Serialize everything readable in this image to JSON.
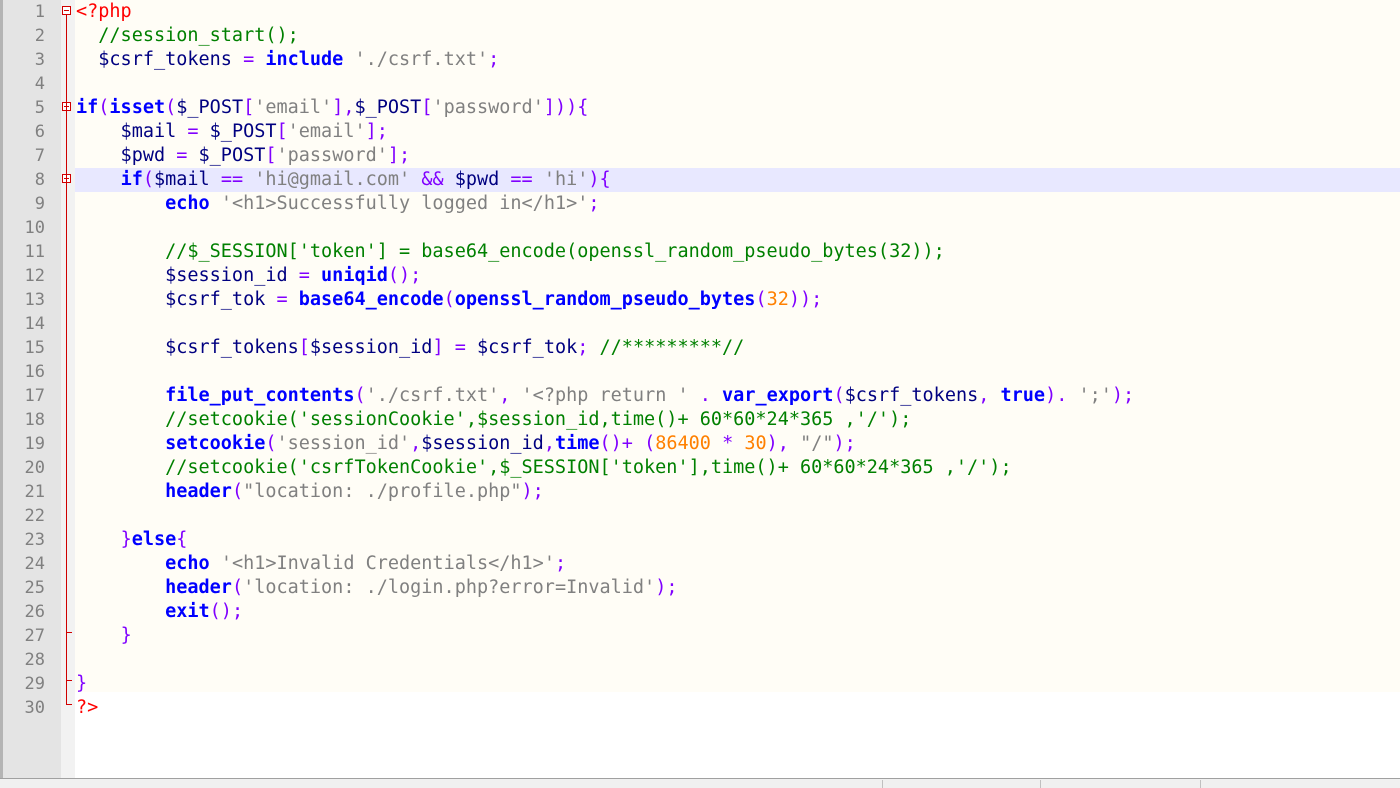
{
  "editor": {
    "colors": {
      "php_tag": "#ff0000",
      "comment": "#008000",
      "variable": "#000080",
      "operator": "#8000ff",
      "keyword": "#0000ff",
      "string": "#808080",
      "number": "#ff8000",
      "current_line": "#e8e8ff",
      "background": "#fffdf6"
    },
    "current_line": 8,
    "line_numbers": [
      "1",
      "2",
      "3",
      "4",
      "5",
      "6",
      "7",
      "8",
      "9",
      "10",
      "11",
      "12",
      "13",
      "14",
      "15",
      "16",
      "17",
      "18",
      "19",
      "20",
      "21",
      "22",
      "23",
      "24",
      "25",
      "26",
      "27",
      "28",
      "29",
      "30"
    ],
    "lines": [
      [
        {
          "t": "tag",
          "v": "<?php"
        }
      ],
      [
        {
          "t": "cmt",
          "v": "  //session_start();"
        }
      ],
      [
        {
          "t": "var",
          "v": "  $csrf_tokens "
        },
        {
          "t": "op",
          "v": "="
        },
        {
          "t": "plain",
          "v": " "
        },
        {
          "t": "kw",
          "v": "include"
        },
        {
          "t": "plain",
          "v": " "
        },
        {
          "t": "str",
          "v": "'./csrf.txt'"
        },
        {
          "t": "op",
          "v": ";"
        }
      ],
      [],
      [
        {
          "t": "kw",
          "v": "if"
        },
        {
          "t": "op",
          "v": "("
        },
        {
          "t": "kw",
          "v": "isset"
        },
        {
          "t": "op",
          "v": "("
        },
        {
          "t": "var",
          "v": "$_POST"
        },
        {
          "t": "op",
          "v": "["
        },
        {
          "t": "str",
          "v": "'email'"
        },
        {
          "t": "op",
          "v": "],"
        },
        {
          "t": "var",
          "v": "$_POST"
        },
        {
          "t": "op",
          "v": "["
        },
        {
          "t": "str",
          "v": "'password'"
        },
        {
          "t": "op",
          "v": "])){"
        }
      ],
      [
        {
          "t": "var",
          "v": "    $mail "
        },
        {
          "t": "op",
          "v": "="
        },
        {
          "t": "var",
          "v": " $_POST"
        },
        {
          "t": "op",
          "v": "["
        },
        {
          "t": "str",
          "v": "'email'"
        },
        {
          "t": "op",
          "v": "];"
        }
      ],
      [
        {
          "t": "var",
          "v": "    $pwd "
        },
        {
          "t": "op",
          "v": "="
        },
        {
          "t": "var",
          "v": " $_POST"
        },
        {
          "t": "op",
          "v": "["
        },
        {
          "t": "str",
          "v": "'password'"
        },
        {
          "t": "op",
          "v": "];"
        }
      ],
      [
        {
          "t": "plain",
          "v": "    "
        },
        {
          "t": "kw",
          "v": "if"
        },
        {
          "t": "op",
          "v": "("
        },
        {
          "t": "var",
          "v": "$mail "
        },
        {
          "t": "op",
          "v": "=="
        },
        {
          "t": "plain",
          "v": " "
        },
        {
          "t": "str",
          "v": "'hi@gmail.com'"
        },
        {
          "t": "plain",
          "v": " "
        },
        {
          "t": "op",
          "v": "&&"
        },
        {
          "t": "var",
          "v": " $pwd "
        },
        {
          "t": "op",
          "v": "=="
        },
        {
          "t": "plain",
          "v": " "
        },
        {
          "t": "str",
          "v": "'hi'"
        },
        {
          "t": "op",
          "v": "){"
        }
      ],
      [
        {
          "t": "plain",
          "v": "        "
        },
        {
          "t": "kw",
          "v": "echo"
        },
        {
          "t": "plain",
          "v": " "
        },
        {
          "t": "str",
          "v": "'<h1>Successfully logged in</h1>'"
        },
        {
          "t": "op",
          "v": ";"
        }
      ],
      [],
      [
        {
          "t": "cmt",
          "v": "        //$_SESSION['token'] = base64_encode(openssl_random_pseudo_bytes(32));"
        }
      ],
      [
        {
          "t": "var",
          "v": "        $session_id "
        },
        {
          "t": "op",
          "v": "="
        },
        {
          "t": "plain",
          "v": " "
        },
        {
          "t": "kw",
          "v": "uniqid"
        },
        {
          "t": "op",
          "v": "();"
        }
      ],
      [
        {
          "t": "var",
          "v": "        $csrf_tok "
        },
        {
          "t": "op",
          "v": "="
        },
        {
          "t": "plain",
          "v": " "
        },
        {
          "t": "kw",
          "v": "base64_encode"
        },
        {
          "t": "op",
          "v": "("
        },
        {
          "t": "kw",
          "v": "openssl_random_pseudo_bytes"
        },
        {
          "t": "op",
          "v": "("
        },
        {
          "t": "num",
          "v": "32"
        },
        {
          "t": "op",
          "v": "));"
        }
      ],
      [],
      [
        {
          "t": "var",
          "v": "        $csrf_tokens"
        },
        {
          "t": "op",
          "v": "["
        },
        {
          "t": "var",
          "v": "$session_id"
        },
        {
          "t": "op",
          "v": "]"
        },
        {
          "t": "plain",
          "v": " "
        },
        {
          "t": "op",
          "v": "="
        },
        {
          "t": "var",
          "v": " $csrf_tok"
        },
        {
          "t": "op",
          "v": ";"
        },
        {
          "t": "plain",
          "v": " "
        },
        {
          "t": "cmt",
          "v": "//*********//"
        }
      ],
      [],
      [
        {
          "t": "plain",
          "v": "        "
        },
        {
          "t": "kw",
          "v": "file_put_contents"
        },
        {
          "t": "op",
          "v": "("
        },
        {
          "t": "str",
          "v": "'./csrf.txt'"
        },
        {
          "t": "op",
          "v": ","
        },
        {
          "t": "plain",
          "v": " "
        },
        {
          "t": "str",
          "v": "'<?php return '"
        },
        {
          "t": "plain",
          "v": " "
        },
        {
          "t": "op",
          "v": "."
        },
        {
          "t": "plain",
          "v": " "
        },
        {
          "t": "kw",
          "v": "var_export"
        },
        {
          "t": "op",
          "v": "("
        },
        {
          "t": "var",
          "v": "$csrf_tokens"
        },
        {
          "t": "op",
          "v": ","
        },
        {
          "t": "plain",
          "v": " "
        },
        {
          "t": "kw",
          "v": "true"
        },
        {
          "t": "op",
          "v": ")."
        },
        {
          "t": "plain",
          "v": " "
        },
        {
          "t": "str",
          "v": "';'"
        },
        {
          "t": "op",
          "v": ");"
        }
      ],
      [
        {
          "t": "cmt",
          "v": "        //setcookie('sessionCookie',$session_id,time()+ 60*60*24*365 ,'/');"
        }
      ],
      [
        {
          "t": "plain",
          "v": "        "
        },
        {
          "t": "kw",
          "v": "setcookie"
        },
        {
          "t": "op",
          "v": "("
        },
        {
          "t": "str",
          "v": "'session_id'"
        },
        {
          "t": "op",
          "v": ","
        },
        {
          "t": "var",
          "v": "$session_id"
        },
        {
          "t": "op",
          "v": ","
        },
        {
          "t": "kw",
          "v": "time"
        },
        {
          "t": "op",
          "v": "()+"
        },
        {
          "t": "plain",
          "v": " "
        },
        {
          "t": "op",
          "v": "("
        },
        {
          "t": "num",
          "v": "86400"
        },
        {
          "t": "plain",
          "v": " "
        },
        {
          "t": "op",
          "v": "*"
        },
        {
          "t": "plain",
          "v": " "
        },
        {
          "t": "num",
          "v": "30"
        },
        {
          "t": "op",
          "v": "),"
        },
        {
          "t": "plain",
          "v": " "
        },
        {
          "t": "str",
          "v": "\"/\""
        },
        {
          "t": "op",
          "v": ");"
        }
      ],
      [
        {
          "t": "cmt",
          "v": "        //setcookie('csrfTokenCookie',$_SESSION['token'],time()+ 60*60*24*365 ,'/');"
        }
      ],
      [
        {
          "t": "plain",
          "v": "        "
        },
        {
          "t": "kw",
          "v": "header"
        },
        {
          "t": "op",
          "v": "("
        },
        {
          "t": "str",
          "v": "\"location: ./profile.php\""
        },
        {
          "t": "op",
          "v": ");"
        }
      ],
      [],
      [
        {
          "t": "plain",
          "v": "    "
        },
        {
          "t": "op",
          "v": "}"
        },
        {
          "t": "kw",
          "v": "else"
        },
        {
          "t": "op",
          "v": "{"
        }
      ],
      [
        {
          "t": "plain",
          "v": "        "
        },
        {
          "t": "kw",
          "v": "echo"
        },
        {
          "t": "plain",
          "v": " "
        },
        {
          "t": "str",
          "v": "'<h1>Invalid Credentials</h1>'"
        },
        {
          "t": "op",
          "v": ";"
        }
      ],
      [
        {
          "t": "plain",
          "v": "        "
        },
        {
          "t": "kw",
          "v": "header"
        },
        {
          "t": "op",
          "v": "("
        },
        {
          "t": "str",
          "v": "'location: ./login.php?error=Invalid'"
        },
        {
          "t": "op",
          "v": ");"
        }
      ],
      [
        {
          "t": "plain",
          "v": "        "
        },
        {
          "t": "kw",
          "v": "exit"
        },
        {
          "t": "op",
          "v": "();"
        }
      ],
      [
        {
          "t": "plain",
          "v": "    "
        },
        {
          "t": "op",
          "v": "}"
        }
      ],
      [],
      [
        {
          "t": "op",
          "v": "}"
        }
      ],
      [
        {
          "t": "tag",
          "v": "?>"
        }
      ]
    ]
  }
}
